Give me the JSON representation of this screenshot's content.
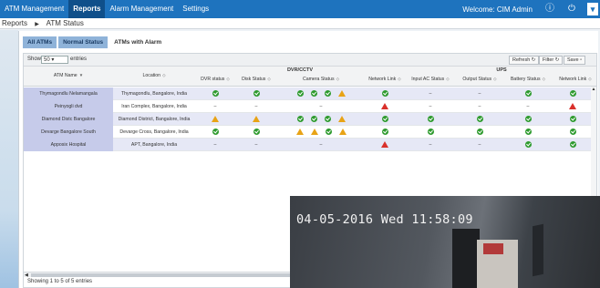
{
  "nav": {
    "items": [
      "ATM Management",
      "Reports",
      "Alarm Management",
      "Settings"
    ],
    "active_index": 1,
    "welcome": "Welcome: CIM Admin"
  },
  "breadcrumb": {
    "root": "Reports",
    "current": "ATM Status"
  },
  "tabs": [
    "All ATMs",
    "Normal Status",
    "ATMs with Alarm"
  ],
  "toolbar": {
    "show_label": "Show",
    "show_value": "50",
    "entries_label": "entries",
    "refresh": "Refresh",
    "filter": "Filter",
    "save": "Save"
  },
  "groups": {
    "dvr": "DVR/CCTV",
    "ups": "UPS"
  },
  "columns": {
    "atm_name": "ATM Name",
    "location": "Location",
    "dvr_status": "DVR status",
    "disk_status": "Disk Status",
    "camera_status": "Camera Status",
    "network_link": "Network Link",
    "input_ac": "Input AC Status",
    "output": "Output Status",
    "battery": "Battery Status",
    "ups_network": "Network Link"
  },
  "rows": [
    {
      "name": "Thymagondlu Nelamangala",
      "location": "Thymagondlu, Bangalore, India",
      "dvr": "ok",
      "disk": "ok",
      "cam": [
        "ok",
        "ok",
        "ok",
        "warn"
      ],
      "net": "ok",
      "ac": "–",
      "out": "–",
      "bat": "ok",
      "unet": "ok"
    },
    {
      "name": "Peinyogli dvd",
      "location": "Iran Complex, Bangalore, India",
      "dvr": "–",
      "disk": "–",
      "cam": [
        "–"
      ],
      "net": "alarm",
      "ac": "–",
      "out": "–",
      "bat": "–",
      "unet": "alarm"
    },
    {
      "name": "Diamond Distc Bangalore",
      "location": "Diamond District, Bangalore, India",
      "dvr": "warn",
      "disk": "warn",
      "cam": [
        "ok",
        "ok",
        "ok",
        "warn"
      ],
      "net": "ok",
      "ac": "ok",
      "out": "ok",
      "bat": "ok",
      "unet": "ok"
    },
    {
      "name": "Devarge Bangalore South",
      "location": "Devarge Cross, Bangalore, India",
      "dvr": "ok",
      "disk": "ok",
      "cam": [
        "warn",
        "warn",
        "ok",
        "warn"
      ],
      "net": "ok",
      "ac": "ok",
      "out": "ok",
      "bat": "ok",
      "unet": "ok"
    },
    {
      "name": "Apposix Hospital",
      "location": "APT, Bangalore, India",
      "dvr": "–",
      "disk": "–",
      "cam": [
        "–"
      ],
      "net": "alarm",
      "ac": "–",
      "out": "–",
      "bat": "ok",
      "unet": "ok"
    }
  ],
  "footer": "Showing 1 to 5 of 5 entries",
  "video": {
    "timestamp": "04-05-2016 Wed 11:58:09"
  },
  "colors": {
    "nav": "#1e73be",
    "tab": "#8fb3d9",
    "name_cell": "#c6cbea",
    "ok": "#2f9b2f",
    "warn": "#e8a316",
    "alarm": "#d9302b"
  }
}
